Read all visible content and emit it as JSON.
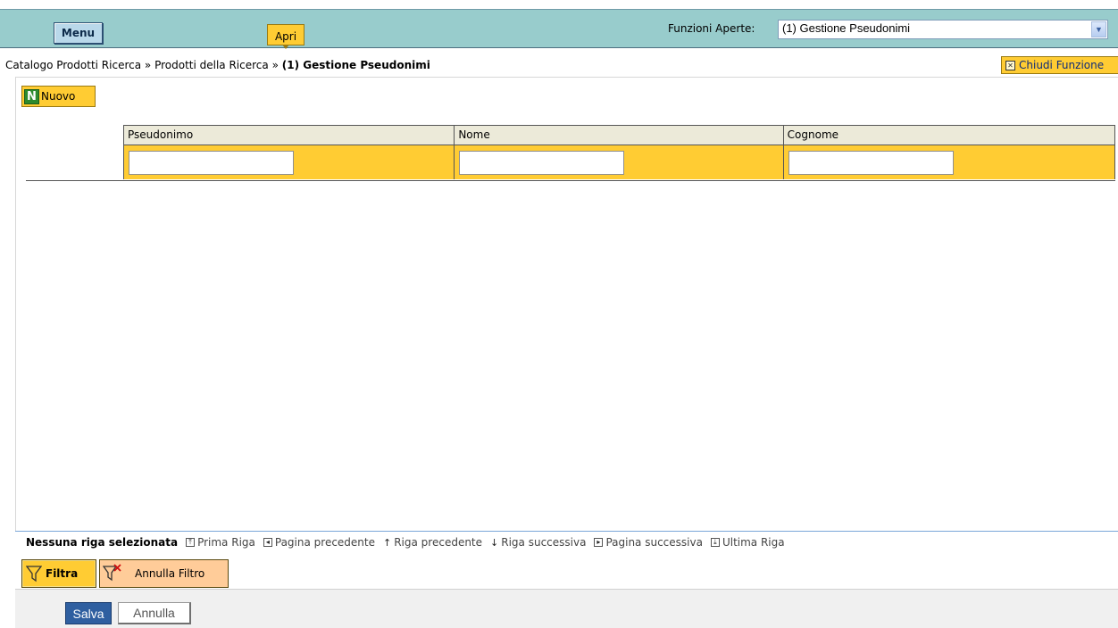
{
  "topbar": {
    "menu_label": "Menu",
    "apri_label": "Apri",
    "funzioni_label": "Funzioni Aperte:",
    "funzioni_selected": "(1) Gestione Pseudonimi"
  },
  "breadcrumb": {
    "items": [
      "Catalogo Prodotti Ricerca",
      "Prodotti della Ricerca"
    ],
    "separator": "»",
    "current": "(1) Gestione Pseudonimi"
  },
  "chiudi_label": "Chiudi Funzione",
  "nuovo_label": "Nuovo",
  "grid": {
    "columns": [
      "Pseudonimo",
      "Nome",
      "Cognome"
    ],
    "filters": [
      "",
      "",
      ""
    ]
  },
  "navbar": {
    "status": "Nessuna riga selezionata",
    "prima_riga": "Prima Riga",
    "pagina_precedente": "Pagina precedente",
    "riga_precedente": "Riga precedente",
    "riga_successiva": "Riga successiva",
    "pagina_successiva": "Pagina successiva",
    "ultima_riga": "Ultima Riga"
  },
  "filtra_label": "Filtra",
  "annulla_filtro_label": "Annulla Filtro",
  "footer": {
    "salva_label": "Salva",
    "annulla_label": "Annulla"
  },
  "colors": {
    "topbar": "#98cccc",
    "accent_yellow": "#ffcc33",
    "accent_orange": "#ffcc99",
    "primary_blue": "#2f5fa0"
  }
}
